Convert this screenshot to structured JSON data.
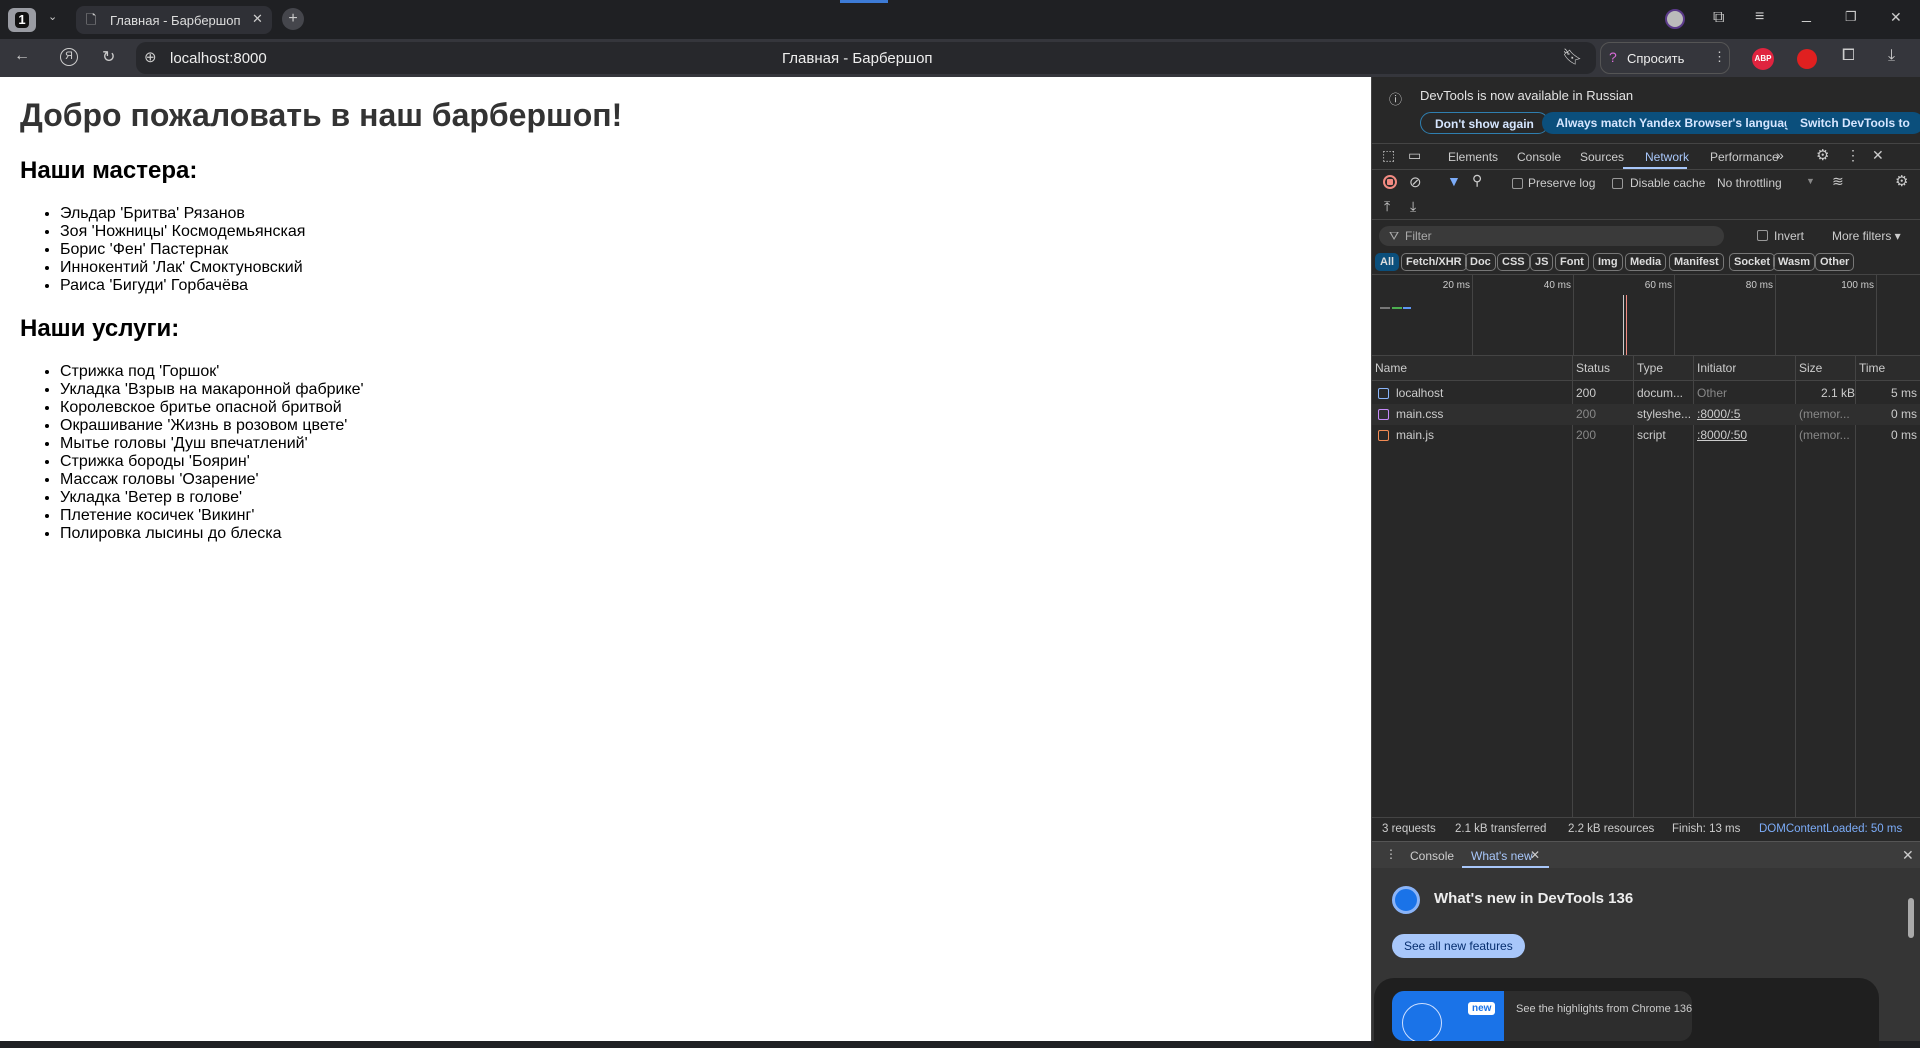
{
  "browser": {
    "tab_count": "1",
    "tab_title": "Главная - Барбершоп",
    "url": "localhost:8000",
    "window_title": "Главная - Барбершоп",
    "ask_label": "Спросить",
    "abp_label": "ABP"
  },
  "page": {
    "title": "Добро пожаловать в наш барбершоп!",
    "masters_heading": "Наши мастера:",
    "masters": [
      "Эльдар 'Бритва' Рязанов",
      "Зоя 'Ножницы' Космодемьянская",
      "Борис 'Фен' Пастернак",
      "Иннокентий 'Лак' Смоктуновский",
      "Раиса 'Бигуди' Горбачёва"
    ],
    "services_heading": "Наши услуги:",
    "services": [
      "Стрижка под 'Горшок'",
      "Укладка 'Взрыв на макаронной фабрике'",
      "Королевское бритье опасной бритвой",
      "Окрашивание 'Жизнь в розовом цвете'",
      "Мытье головы 'Душ впечатлений'",
      "Стрижка бороды 'Боярин'",
      "Массаж головы 'Озарение'",
      "Укладка 'Ветер в голове'",
      "Плетение косичек 'Викинг'",
      "Полировка лысины до блеска"
    ]
  },
  "devtools": {
    "infobar": {
      "message": "DevTools is now available in Russian",
      "dont_show": "Don't show again",
      "always_match": "Always match Yandex Browser's language",
      "switch": "Switch DevTools to"
    },
    "tabs": [
      "Elements",
      "Console",
      "Sources",
      "Network",
      "Performance"
    ],
    "active_tab": "Network",
    "toolbar": {
      "preserve_log": "Preserve log",
      "disable_cache": "Disable cache",
      "throttling": "No throttling"
    },
    "filter": {
      "placeholder": "Filter",
      "invert": "Invert",
      "more_filters": "More filters"
    },
    "type_chips": [
      "All",
      "Fetch/XHR",
      "Doc",
      "CSS",
      "JS",
      "Font",
      "Img",
      "Media",
      "Manifest",
      "Socket",
      "Wasm",
      "Other"
    ],
    "timeline_ticks": [
      "20 ms",
      "40 ms",
      "60 ms",
      "80 ms",
      "100 ms"
    ],
    "columns": [
      "Name",
      "Status",
      "Type",
      "Initiator",
      "Size",
      "Time"
    ],
    "requests": [
      {
        "name": "localhost",
        "status": "200",
        "type": "docum...",
        "initiator": "Other",
        "size": "2.1 kB",
        "time": "5 ms",
        "icon": "document-icon",
        "color": "#8ab4f8"
      },
      {
        "name": "main.css",
        "status": "200",
        "type": "styleshe...",
        "initiator": ":8000/:5",
        "size": "(memor...",
        "time": "0 ms",
        "icon": "stylesheet-icon",
        "color": "#c58af9"
      },
      {
        "name": "main.js",
        "status": "200",
        "type": "script",
        "initiator": ":8000/:50",
        "size": "(memor...",
        "time": "0 ms",
        "icon": "script-icon",
        "color": "#f28b54"
      }
    ],
    "summary": {
      "requests": "3 requests",
      "transferred": "2.1 kB transferred",
      "resources": "2.2 kB resources",
      "finish": "Finish: 13 ms",
      "dcl": "DOMContentLoaded: 50 ms"
    },
    "drawer": {
      "tabs": [
        "Console",
        "What's new"
      ],
      "heading": "What's new in DevTools 136",
      "see_all": "See all new features",
      "badge": "new",
      "highlight": "See the highlights from Chrome 136"
    }
  }
}
